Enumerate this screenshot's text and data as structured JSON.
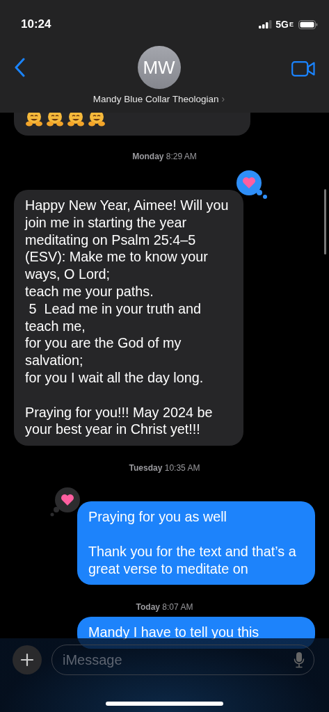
{
  "status_bar": {
    "time": "10:24",
    "network": "5G",
    "network_suffix": "E"
  },
  "contact": {
    "initials": "MW",
    "name": "Mandy Blue Collar Theologian",
    "chevron": "›"
  },
  "messages": [
    {
      "kind": "emoji_received"
    },
    {
      "kind": "timestamp",
      "text": "**Monday** 8:29 AM"
    },
    {
      "kind": "received",
      "text": "Happy New Year, Aimee! Will you join me in starting the year meditating on Psalm 25:4–5 (ESV): Make me to know your ways, O Lord;\nteach me your paths.\n 5  Lead me in your truth and teach me,\nfor you are the God of my salvation;\nfor you I wait all the day long.\n\nPraying for you!!! May 2024 be your best year in Christ yet!!!",
      "reaction": {
        "kind": "heart"
      }
    },
    {
      "kind": "timestamp",
      "text": "**Tuesday** 10:35 AM"
    },
    {
      "kind": "sent",
      "text": "Praying for you as well\n\nThank you for the text and that’s a great verse to meditate on",
      "reaction": {
        "kind": "heart"
      }
    },
    {
      "kind": "timestamp",
      "text": "**Today** 8:07 AM"
    },
    {
      "kind": "sent",
      "text": "Mandy I have to tell you this"
    }
  ],
  "composer": {
    "placeholder": "iMessage"
  }
}
